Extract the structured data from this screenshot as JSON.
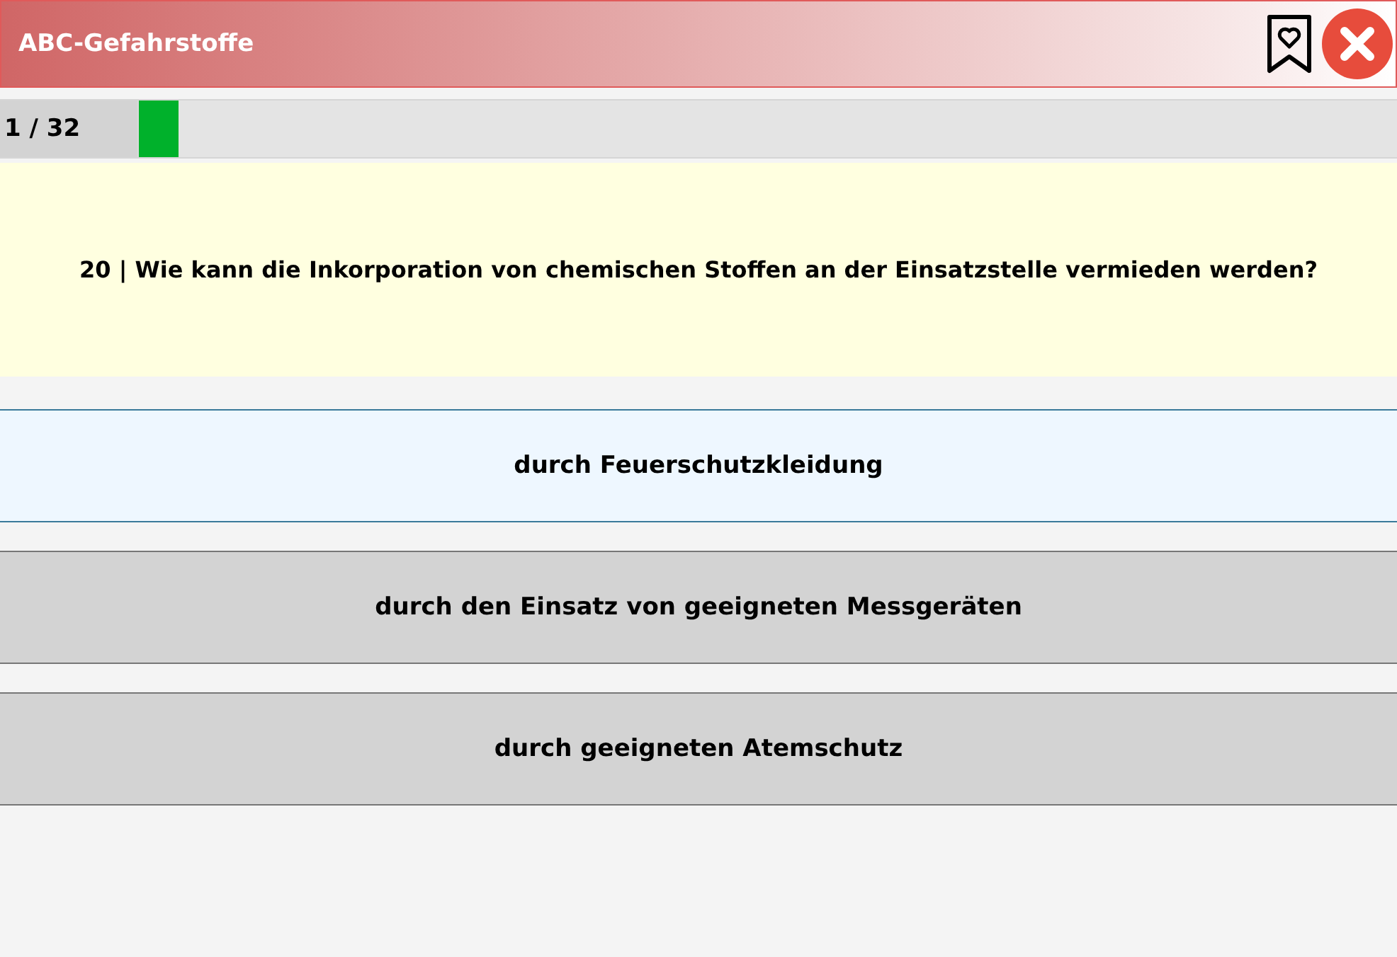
{
  "header": {
    "title": "ABC-Gefahrstoffe"
  },
  "progress": {
    "counter": "1 / 32",
    "level": 0.03125
  },
  "question": {
    "text": "20 | Wie kann die Inkorporation von chemischen Stoffen an der Einsatzstelle vermieden werden?"
  },
  "answers": [
    {
      "text": "durch Feuerschutzkleidung",
      "selected": true
    },
    {
      "text": "durch den Einsatz von geeigneten Messgeräten",
      "selected": false
    },
    {
      "text": "durch geeigneten Atemschutz",
      "selected": false
    }
  ]
}
